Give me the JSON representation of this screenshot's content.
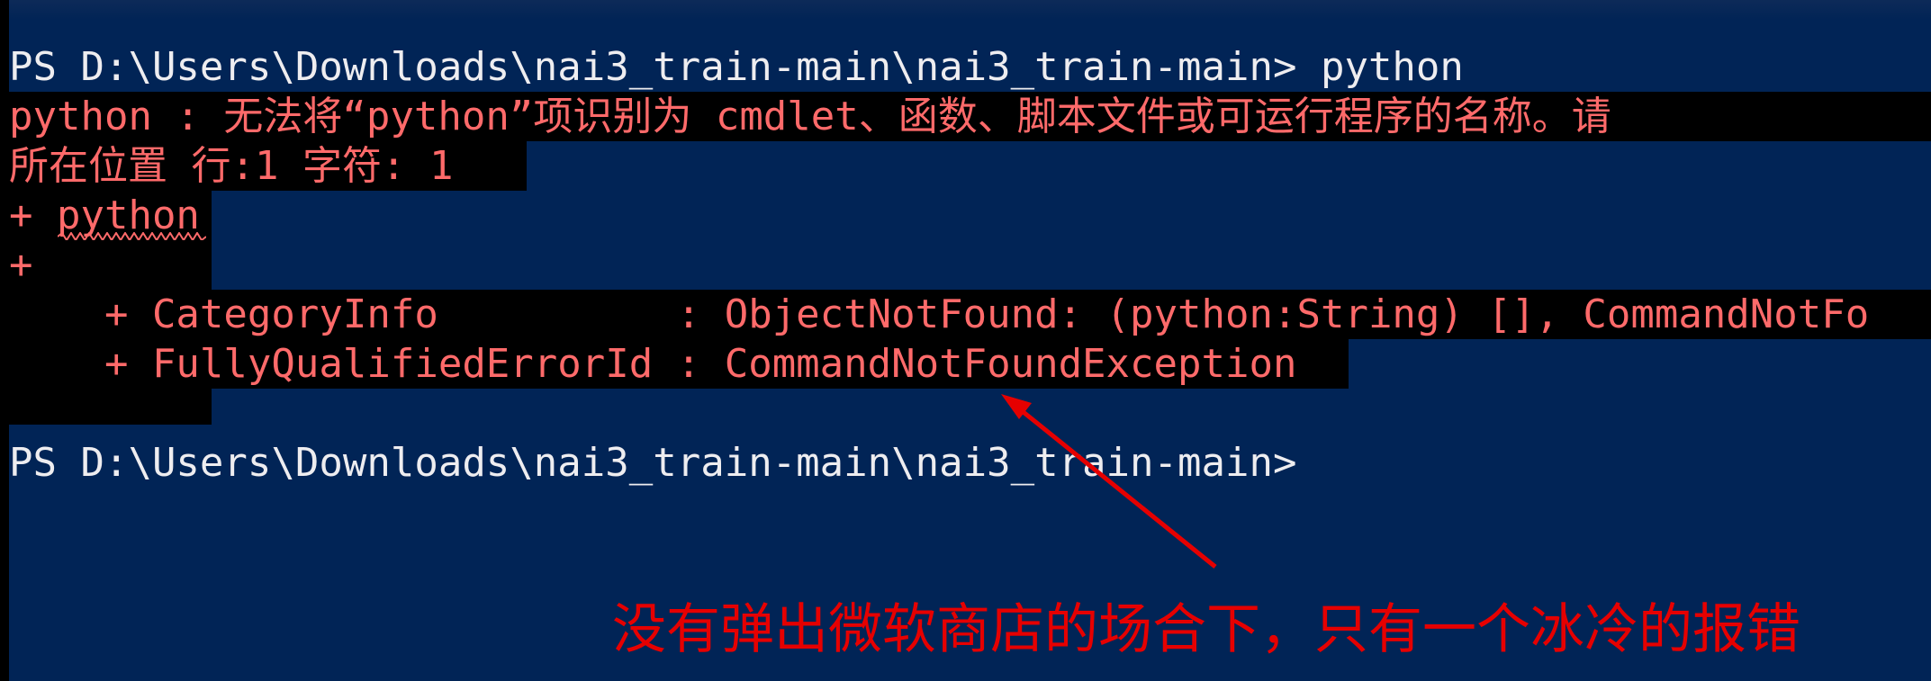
{
  "terminal": {
    "prompt_line_1": "PS D:\\Users\\Downloads\\nai3_train-main\\nai3_train-main> python",
    "error_lines": [
      "python : 无法将“python”项识别为 cmdlet、函数、脚本文件或可运行程序的名称。请",
      "所在位置 行:1 字符: 1",
      "+ python",
      "+",
      "    + CategoryInfo          : ObjectNotFound: (python:String) [], CommandNotFo",
      "    + FullyQualifiedErrorId : CommandNotFoundException"
    ],
    "prompt_line_2": "PS D:\\Users\\Downloads\\nai3_train-main\\nai3_train-main>"
  },
  "annotation": {
    "text": "没有弹出微软商店的场合下，只有一个冰冷的报错"
  },
  "colors": {
    "background": "#012456",
    "prompt_text": "#eeedf0",
    "error_text": "#ff6a6a",
    "error_background": "#000000",
    "annotation": "#e60000"
  }
}
